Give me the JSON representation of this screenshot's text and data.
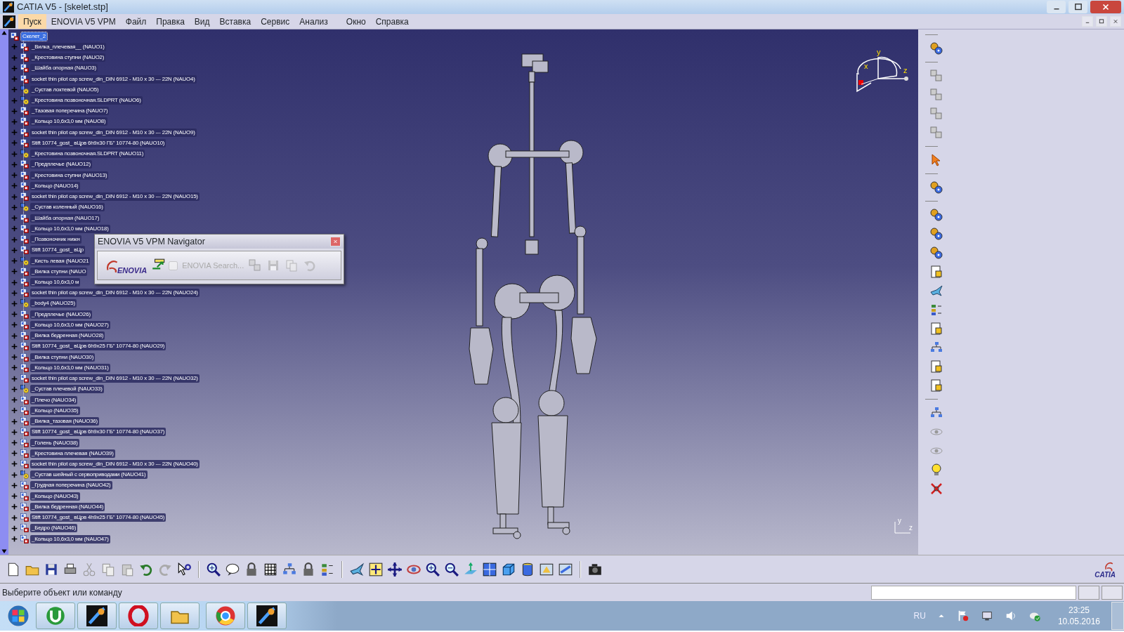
{
  "window": {
    "title": "CATIA V5 - [skelet.stp]"
  },
  "menu": [
    {
      "label": "Пуск",
      "selected": true
    },
    {
      "label": "ENOVIA V5 VPM",
      "selected": false
    },
    {
      "label": "Файл",
      "selected": false
    },
    {
      "label": "Правка",
      "selected": false
    },
    {
      "label": "Вид",
      "selected": false
    },
    {
      "label": "Вставка",
      "selected": false
    },
    {
      "label": "Сервис",
      "selected": false
    },
    {
      "label": "Анализ",
      "selected": false
    },
    {
      "label": "Окно",
      "selected": false
    },
    {
      "label": "Справка",
      "selected": false
    }
  ],
  "tree": {
    "label": "Скелет_2",
    "selected": true,
    "children": [
      {
        "label": "_Вилка_плечевая__ (NAUO1)",
        "kind": "product",
        "expanded": false
      },
      {
        "label": "_Крестовина ступни (NAUO2)",
        "kind": "product",
        "expanded": false
      },
      {
        "label": "_Шайба опорная (NAUO3)",
        "kind": "product",
        "expanded": false
      },
      {
        "label": "socket thin pilot cap screw_din_DIN 6912 - M10 x 30 --- 22N (NAUO4)",
        "kind": "product",
        "expanded": false
      },
      {
        "label": "_Сустав локтевой (NAUO5)",
        "kind": "assembly",
        "expanded": false
      },
      {
        "label": "_Крестовина позвоночная.SLDPRT (NAUO6)",
        "kind": "assembly",
        "expanded": false
      },
      {
        "label": "_Тазовая поперечина (NAUO7)",
        "kind": "product",
        "expanded": false
      },
      {
        "label": "_Кольцо 10,6x3,0 мм (NAUO8)",
        "kind": "product",
        "expanded": false
      },
      {
        "label": "socket thin pilot cap screw_din_DIN 6912 - M10 x 30 --- 22N (NAUO9)",
        "kind": "product",
        "expanded": false
      },
      {
        "label": "Stift 10774_gost_ вЦрв 6h9x30 ГБ\" 10774-80 (NAUO10)",
        "kind": "product",
        "expanded": false
      },
      {
        "label": "_Крестовина позвоночная.SLDPRT (NAUO11)",
        "kind": "assembly",
        "expanded": false
      },
      {
        "label": "_Предплечье (NAUO12)",
        "kind": "product",
        "expanded": false
      },
      {
        "label": "_Крестовина ступни (NAUO13)",
        "kind": "product",
        "expanded": false
      },
      {
        "label": "_Кольцо (NAUO14)",
        "kind": "product",
        "expanded": false
      },
      {
        "label": "socket thin pilot cap screw_din_DIN 6912 - M10 x 30 --- 22N (NAUO15)",
        "kind": "product",
        "expanded": false
      },
      {
        "label": "_Сустав коленный (NAUO16)",
        "kind": "assembly",
        "expanded": false
      },
      {
        "label": "_Шайба опорная (NAUO17)",
        "kind": "product",
        "expanded": false
      },
      {
        "label": "_Кольцо 10,6x3,0 мм (NAUO18)",
        "kind": "product",
        "expanded": false
      },
      {
        "label": "_Позвоночник нижн",
        "kind": "product",
        "expanded": false
      },
      {
        "label": "Stift 10774_gost_ вЦр",
        "kind": "product",
        "expanded": false
      },
      {
        "label": "_Кисть левая (NAUO21",
        "kind": "assembly",
        "expanded": false
      },
      {
        "label": "_Вилка ступни (NAUO",
        "kind": "product",
        "expanded": false
      },
      {
        "label": "_Кольцо 10,6x3,0 м",
        "kind": "product",
        "expanded": false
      },
      {
        "label": "socket thin pilot cap screw_din_DIN 6912 - M10 x 30 --- 22N (NAUO24)",
        "kind": "product",
        "expanded": false
      },
      {
        "label": "_body4 (NAUO25)",
        "kind": "assembly",
        "expanded": false
      },
      {
        "label": "_Предплечье (NAUO26)",
        "kind": "product",
        "expanded": false
      },
      {
        "label": "_Кольцо 10,6x3,0 мм (NAUO27)",
        "kind": "product",
        "expanded": false
      },
      {
        "label": "_Вилка бедренная (NAUO28)",
        "kind": "product",
        "expanded": false
      },
      {
        "label": "Stift 10774_gost_ вЦрв 6h9x25 ГБ\" 10774-80 (NAUO29)",
        "kind": "product",
        "expanded": false
      },
      {
        "label": "_Вилка ступни (NAUO30)",
        "kind": "product",
        "expanded": false
      },
      {
        "label": "_Кольцо 10,6x3,0 мм (NAUO31)",
        "kind": "product",
        "expanded": false
      },
      {
        "label": "socket thin pilot cap screw_din_DIN 6912 - M10 x 30 --- 22N (NAUO32)",
        "kind": "product",
        "expanded": false
      },
      {
        "label": "_Сустав плечевой (NAUO33)",
        "kind": "assembly",
        "expanded": false
      },
      {
        "label": "_Плечо (NAUO34)",
        "kind": "product",
        "expanded": false
      },
      {
        "label": "_Кольцо (NAUO35)",
        "kind": "product",
        "expanded": false
      },
      {
        "label": "_Вилка_тазовая (NAUO36)",
        "kind": "product",
        "expanded": false
      },
      {
        "label": "Stift 10774_gost_ вЦрв 6h9x30 ГБ\" 10774-80 (NAUO37)",
        "kind": "product",
        "expanded": false
      },
      {
        "label": "_Голень (NAUO38)",
        "kind": "product",
        "expanded": false
      },
      {
        "label": "_Крестовина плечевая (NAUO39)",
        "kind": "product",
        "expanded": false
      },
      {
        "label": "socket thin pilot cap screw_din_DIN 6912 - M10 x 30 --- 22N (NAUO40)",
        "kind": "product",
        "expanded": false
      },
      {
        "label": "_Сустав шейный с сервоприводами (NAUO41)",
        "kind": "assembly",
        "expanded": false
      },
      {
        "label": "_Грудная поперечина (NAUO42)",
        "kind": "product",
        "expanded": false
      },
      {
        "label": "_Кольцо (NAUO43)",
        "kind": "product",
        "expanded": false
      },
      {
        "label": "_Вилка бедренная (NAUO44)",
        "kind": "product",
        "expanded": false
      },
      {
        "label": "Stift 10774_gost_ вЦрв 4h9x25 ГБ\" 10774-80 (NAUO45)",
        "kind": "product",
        "expanded": false
      },
      {
        "label": "_Бедро (NAUO46)",
        "kind": "product",
        "expanded": false
      },
      {
        "label": "_Кольцо 10,6x3,0 мм (NAUO47)",
        "kind": "product",
        "expanded": false
      }
    ]
  },
  "enovia_dialog": {
    "title": "ENOVIA V5 VPM Navigator",
    "logo_text": "ENOVIA",
    "search": {
      "label": "ENOVIA Search...",
      "checked": false,
      "disabled": true
    }
  },
  "compass": {
    "labels": [
      "x",
      "y",
      "z"
    ]
  },
  "mini_axis": {
    "labels": [
      "y",
      "z"
    ]
  },
  "catia_logo": "CATIA",
  "status_bar": {
    "message": "Выберите объект или команду"
  },
  "taskbar": {
    "language": "RU",
    "time": "23:25",
    "date": "10.05.2016"
  }
}
